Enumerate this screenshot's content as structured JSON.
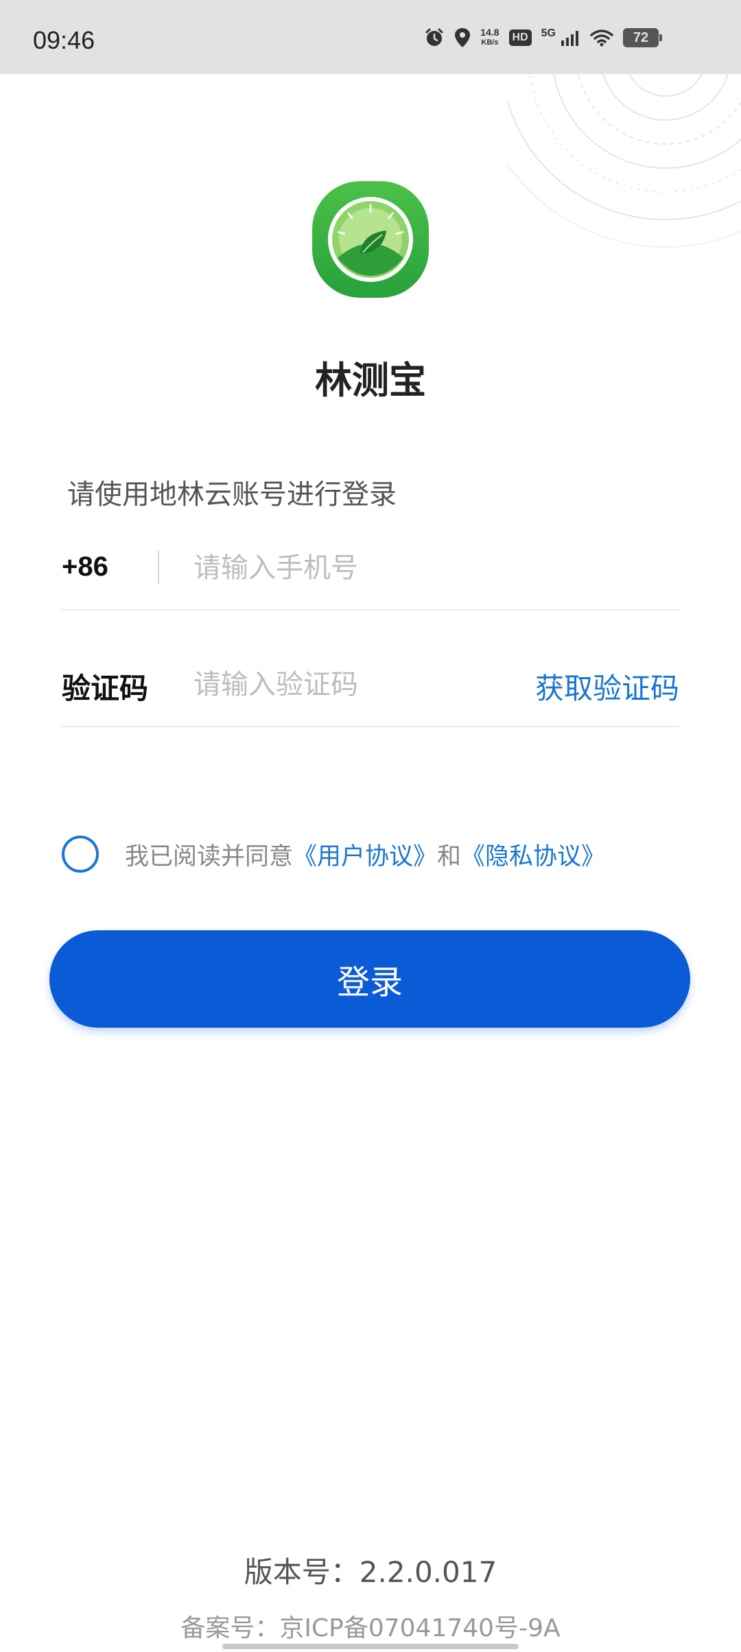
{
  "status_bar": {
    "time": "09:46",
    "net_speed_value": "14.8",
    "net_speed_unit": "KB/s",
    "hd_label": "HD",
    "network_label": "5G",
    "battery_level": "72",
    "icons": [
      "alarm-icon",
      "location-icon",
      "hd-icon",
      "signal-icon",
      "wifi-icon",
      "battery-icon"
    ]
  },
  "app": {
    "name": "林测宝",
    "logo_icon": "leaf-gauge-logo",
    "brand_color": "#3aa93a"
  },
  "login": {
    "hint": "请使用地林云账号进行登录",
    "country_code": "+86",
    "phone_placeholder": "请输入手机号",
    "code_label": "验证码",
    "code_placeholder": "请输入验证码",
    "get_code_label": "获取验证码",
    "agreement_prefix": "我已阅读并同意",
    "user_agreement": "《用户协议》",
    "agreement_and": "和",
    "privacy_agreement": "《隐私协议》",
    "submit_label": "登录",
    "accent_color": "#0b5ad6",
    "link_color": "#1976d2"
  },
  "footer": {
    "version": "版本号：2.2.0.017",
    "beian": "备案号：京ICP备07041740号-9A"
  }
}
